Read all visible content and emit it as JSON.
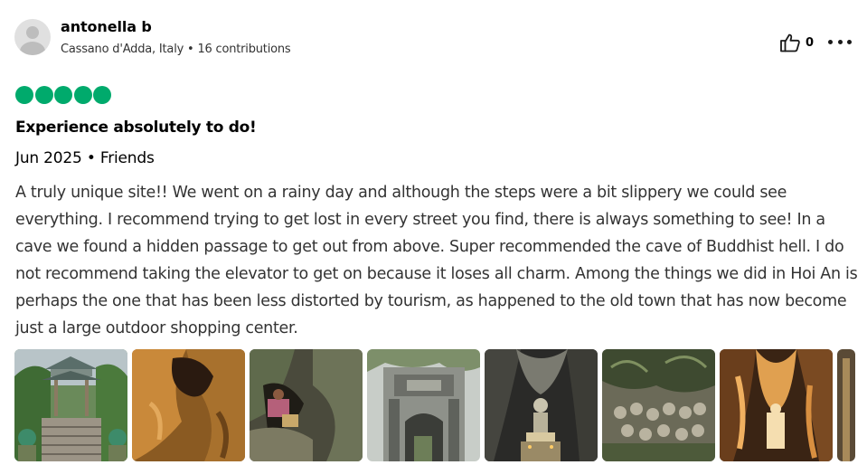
{
  "reviewer": {
    "name": "antonella b",
    "meta": "Cassano d'Adda, Italy • 16 contributions",
    "avatar_icon": "default-avatar-icon"
  },
  "actions": {
    "helpful_icon": "thumbs-up-icon",
    "helpful_count": "0",
    "more_icon": "more-options-icon"
  },
  "rating": {
    "score": 5,
    "max": 5,
    "color": "#00aa6c"
  },
  "review": {
    "title": "Experience absolutely to do!",
    "date_line": "Jun 2025 • Friends",
    "text": "A truly unique site!! We went on a rainy day and although the steps were a bit slippery we could see everything. I recommend trying to get lost in every street you find, there is always something to see! In a cave we found a hidden passage to get out from above. Super recommended the cave of Buddhist hell. I do not recommend taking the elevator to get on because it loses all charm. Among the things we did in Hoi An is perhaps the one that has been less distorted by tourism, as happened to the old town that has now become just a large outdoor shopping center."
  },
  "photos": [
    {
      "subject": "pagoda-gate-with-stairs"
    },
    {
      "subject": "cave-rock-formations"
    },
    {
      "subject": "cave-entrance-with-visitor"
    },
    {
      "subject": "stone-temple-gate"
    },
    {
      "subject": "buddha-statue-in-cave"
    },
    {
      "subject": "stone-carvings-in-cave"
    },
    {
      "subject": "illuminated-cave-interior"
    },
    {
      "subject": "cave-partial"
    }
  ]
}
